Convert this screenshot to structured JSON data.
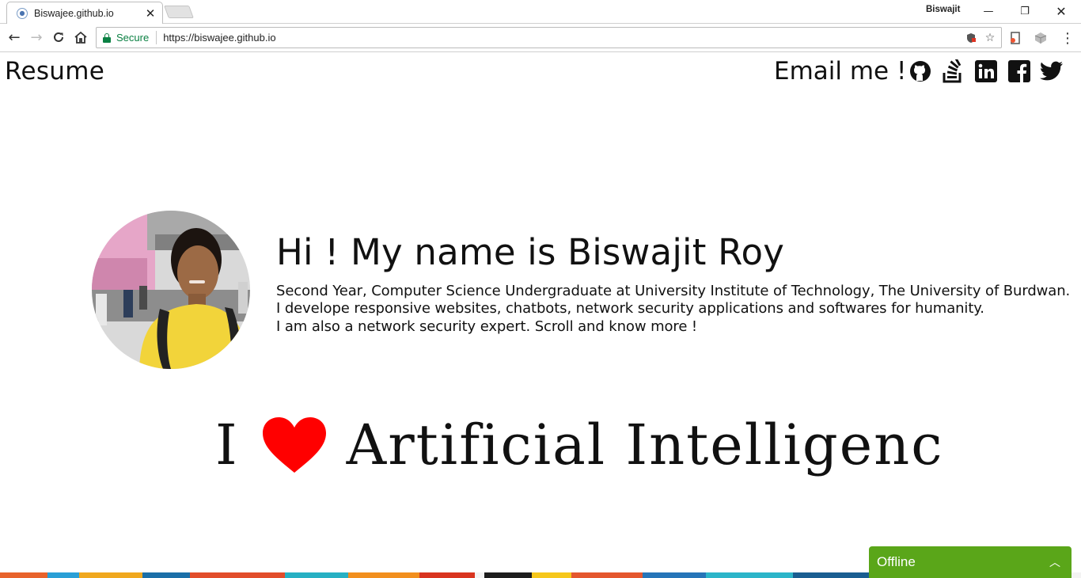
{
  "browser": {
    "tab_title": "Biswajee.github.io",
    "tab_favicon": "globe-icon",
    "profile_name": "Biswajit",
    "secure_label": "Secure",
    "url": "https://biswajee.github.io"
  },
  "nav": {
    "resume_label": "Resume",
    "email_label": "Email me !",
    "social": [
      "github-icon",
      "stackoverflow-icon",
      "linkedin-icon",
      "facebook-icon",
      "twitter-icon"
    ]
  },
  "hero": {
    "heading": "Hi ! My name is Biswajit Roy",
    "line1": "Second Year, Computer Science Undergraduate at University Institute of Technology, The University of Burdwan.",
    "line2": "I develope responsive websites, chatbots, network security applications and softwares for humanity.",
    "line3": "I am also a network security expert. Scroll and know more !"
  },
  "banner": {
    "prefix": "I",
    "heart_color": "#ff0000",
    "suffix": "Artificial Intelligenc"
  },
  "chat_widget": {
    "status": "Offline",
    "color": "#5aa619"
  }
}
